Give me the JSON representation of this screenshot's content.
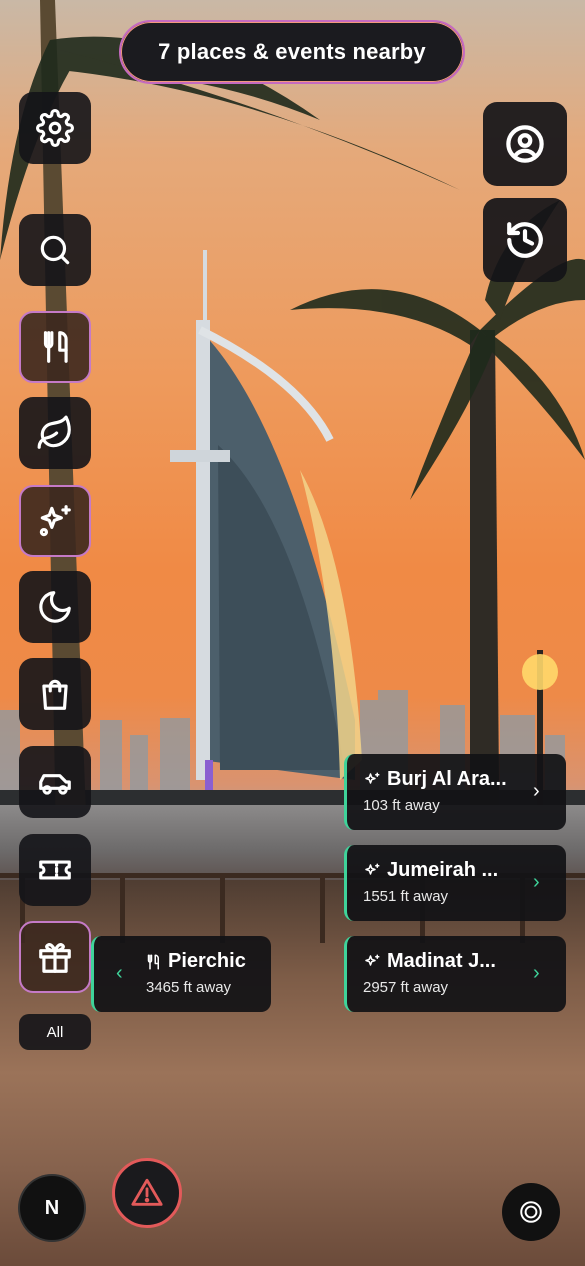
{
  "header": {
    "nearby_label": "7 places & events nearby"
  },
  "sidebar": {
    "items": [
      {
        "icon": "gear-icon"
      },
      {
        "icon": "search-icon"
      },
      {
        "icon": "fork-knife-icon"
      },
      {
        "icon": "leaf-icon"
      },
      {
        "icon": "sparkles-icon"
      },
      {
        "icon": "moon-icon"
      },
      {
        "icon": "shopping-bag-icon"
      },
      {
        "icon": "car-icon"
      },
      {
        "icon": "ticket-icon"
      },
      {
        "icon": "gift-icon"
      }
    ],
    "all_label": "All"
  },
  "top_right": {
    "profile_icon": "user-circle-icon",
    "history_icon": "history-icon"
  },
  "cards": [
    {
      "title": "Burj Al Ara...",
      "distance": "103 ft away",
      "icon": "sparkles-icon"
    },
    {
      "title": "Jumeirah ...",
      "distance": "1551 ft away",
      "icon": "sparkles-icon"
    },
    {
      "title": "Madinat J...",
      "distance": "2957 ft away",
      "icon": "sparkles-icon"
    },
    {
      "title": "Pierchic",
      "distance": "3465 ft away",
      "icon": "fork-knife-icon"
    }
  ],
  "bottom": {
    "n_badge": "N",
    "alert_icon": "warning-triangle-icon",
    "target_icon": "target-icon"
  },
  "colors": {
    "accent_green": "#3fd39a",
    "accent_pink": "#c57ac7",
    "alert_red": "#e35a5a"
  }
}
